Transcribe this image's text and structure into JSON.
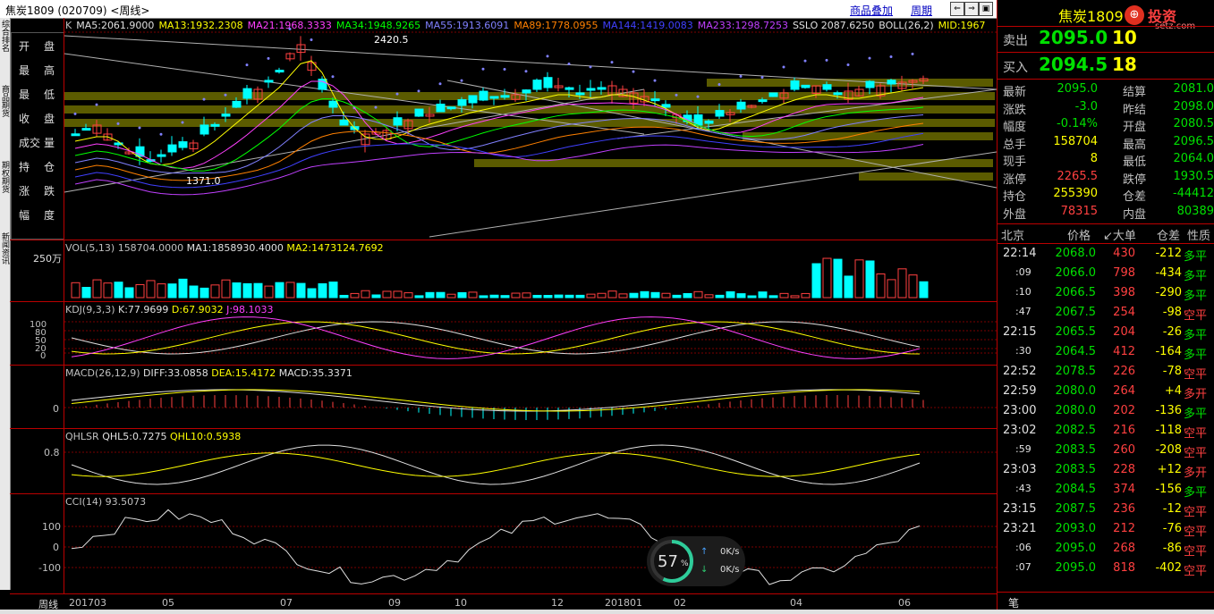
{
  "window": {
    "title": "焦炭1809 (020709) <周线>",
    "links": [
      "商品叠加",
      "周期"
    ]
  },
  "left_tabs": [
    "综合排名",
    "商品期货",
    "期权期货",
    "新闻资讯"
  ],
  "left_panel": {
    "rows": [
      {
        "a": "开",
        "b": "盘"
      },
      {
        "a": "最",
        "b": "高"
      },
      {
        "a": "最",
        "b": "低"
      },
      {
        "a": "收",
        "b": "盘"
      },
      {
        "a": "成交",
        "b": "量"
      },
      {
        "a": "持",
        "b": "仓"
      },
      {
        "a": "涨",
        "b": "跌"
      },
      {
        "a": "幅",
        "b": "度"
      }
    ]
  },
  "main_pane": {
    "header": [
      {
        "t": "K",
        "c": "#c0c0c0"
      },
      {
        "t": "MA5:2061.9000",
        "c": "#e0e0e0"
      },
      {
        "t": "MA13:1932.2308",
        "c": "#ffff00"
      },
      {
        "t": "MA21:1968.3333",
        "c": "#ff40ff"
      },
      {
        "t": "MA34:1948.9265",
        "c": "#00ff00"
      },
      {
        "t": "MA55:1913.6091",
        "c": "#8080ff"
      },
      {
        "t": "MA89:1778.0955",
        "c": "#ff8000"
      },
      {
        "t": "MA144:1419.0083",
        "c": "#4040ff"
      },
      {
        "t": "MA233:1298.7253",
        "c": "#c040ff"
      },
      {
        "t": "SSLO 2087.6250",
        "c": "#e0e0e0"
      },
      {
        "t": "BOLL(26,2)",
        "c": "#e0e0e0"
      },
      {
        "t": "MID:1967",
        "c": "#ffff00"
      }
    ],
    "high_label": "2420.5",
    "low_label": "1371.0"
  },
  "vol_pane": {
    "header": "VOL(5,13) 158704.0000",
    "ma1": "MA1:1858930.4000",
    "ma2": "MA2:1473124.7692",
    "ylabel": "250万"
  },
  "kdj_pane": {
    "header": "KDJ(9,3,3)",
    "k": "K:77.9699",
    "d": "D:67.9032",
    "j": "J:98.1033",
    "yticks": [
      "100",
      "80",
      "50",
      "20",
      "0"
    ]
  },
  "macd_pane": {
    "header": "MACD(26,12,9)",
    "diff": "DIFF:33.0858",
    "dea": "DEA:15.4172",
    "macd": "MACD:35.3371",
    "ytick": "0"
  },
  "qhlsr_pane": {
    "header": "QHLSR",
    "q5": "QHL5:0.7275",
    "q10": "QHL10:0.5938",
    "ytick": "0.8"
  },
  "cci_pane": {
    "header": "CCI(14) 93.5073",
    "yticks": [
      "100",
      "0",
      "-100"
    ]
  },
  "x_axis": {
    "label": "周线",
    "ticks": [
      "201703",
      "05",
      "07",
      "09",
      "10",
      "12",
      "201801",
      "02",
      "04",
      "06"
    ]
  },
  "network_widget": {
    "percent": "57",
    "unit": "%",
    "up": "0K/s",
    "down": "0K/s"
  },
  "right_panel": {
    "name": "焦炭1809",
    "brand": "投资",
    "site": "setz.com",
    "sell_label": "卖出",
    "sell_price": "2095.0",
    "sell_vol": "10",
    "buy_label": "买入",
    "buy_price": "2094.5",
    "buy_vol": "18",
    "stats": [
      [
        "最新",
        "2095.0",
        "结算",
        "2081.0"
      ],
      [
        "涨跌",
        "-3.0",
        "昨结",
        "2098.0"
      ],
      [
        "幅度",
        "-0.14%",
        "开盘",
        "2080.5"
      ],
      [
        "总手",
        "158704",
        "最高",
        "2096.5"
      ],
      [
        "现手",
        "8",
        "最低",
        "2064.0"
      ],
      [
        "涨停",
        "2265.5",
        "跌停",
        "1930.5"
      ],
      [
        "持仓",
        "255390",
        "仓差",
        "-44412"
      ],
      [
        "外盘",
        "78315",
        "内盘",
        "80389"
      ]
    ],
    "tick_headers": [
      "北京",
      "价格",
      "↙大单",
      "仓差",
      "性质"
    ],
    "ticks": [
      [
        "22:14",
        "2068.0",
        "430",
        "-212",
        "多平"
      ],
      [
        ":09",
        "2066.0",
        "798",
        "-434",
        "多平"
      ],
      [
        ":10",
        "2066.5",
        "398",
        "-290",
        "多平"
      ],
      [
        ":47",
        "2067.5",
        "254",
        "-98",
        "空平"
      ],
      [
        "22:15",
        "2065.5",
        "204",
        "-26",
        "多平"
      ],
      [
        ":30",
        "2064.5",
        "412",
        "-164",
        "多平"
      ],
      [
        "22:52",
        "2078.5",
        "226",
        "-78",
        "空平"
      ],
      [
        "22:59",
        "2080.0",
        "264",
        "+4",
        "多开"
      ],
      [
        "23:00",
        "2080.0",
        "202",
        "-136",
        "多平"
      ],
      [
        "23:02",
        "2082.5",
        "216",
        "-118",
        "空平"
      ],
      [
        ":59",
        "2083.5",
        "260",
        "-208",
        "空平"
      ],
      [
        "23:03",
        "2083.5",
        "228",
        "+12",
        "多开"
      ],
      [
        ":43",
        "2084.5",
        "374",
        "-156",
        "多平"
      ],
      [
        "23:15",
        "2087.5",
        "236",
        "-12",
        "空平"
      ],
      [
        "23:21",
        "2093.0",
        "212",
        "-76",
        "空平"
      ],
      [
        ":06",
        "2095.0",
        "268",
        "-86",
        "空平"
      ],
      [
        ":07",
        "2095.0",
        "818",
        "-402",
        "空平"
      ]
    ],
    "bottom_tab": "笔"
  }
}
